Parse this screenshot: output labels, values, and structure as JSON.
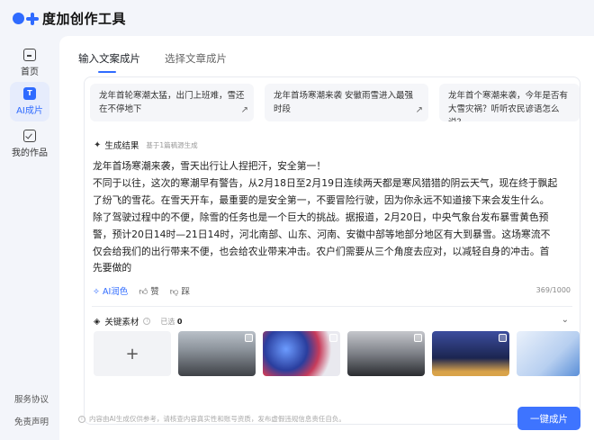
{
  "app": {
    "title": "度加创作工具"
  },
  "sidebar": {
    "items": [
      {
        "label": "首页",
        "icon": "home-icon"
      },
      {
        "label": "AI成片",
        "icon": "ai-icon",
        "active": true
      },
      {
        "label": "我的作品",
        "icon": "check-icon"
      }
    ],
    "links": [
      "服务协议",
      "免责声明"
    ]
  },
  "main": {
    "tabs": [
      {
        "label": "输入文案成片",
        "active": true
      },
      {
        "label": "选择文章成片",
        "active": false
      }
    ],
    "suggestions": [
      "龙年首轮寒潮太猛，出门上班难，雪还在不停地下",
      "龙年首场寒潮来袭 安徽雨雪进入最强时段",
      "龙年首个寒潮来袭，今年是否有大雪灾祸？听听农民谚语怎么说？"
    ],
    "result": {
      "title": "生成结果",
      "subtitle": "基于1篇稿源生成",
      "body": "龙年首场寒潮来袭，雪天出行让人捏把汗，安全第一！\n不同于以往，这次的寒潮早有警告，从2月18日至2月19日连续两天都是寒风猎猎的阴云天气，现在终于飘起了纷飞的雪花。在雪天开车，最重要的是安全第一，不要冒险行驶，因为你永远不知道接下来会发生什么。除了驾驶过程中的不便，除雪的任务也是一个巨大的挑战。据报道，2月20日，中央气象台发布暴雪黄色预警，预计20日14时—21日14时，河北南部、山东、河南、安徽中部等地部分地区有大到暴雪。这场寒流不仅会给我们的出行带来不便，也会给农业带来冲击。农户们需要从三个角度去应对，以减轻自身的冲击。首先要做的",
      "actions": {
        "ai": "AI润色",
        "like": "赞",
        "dislike": "踩"
      },
      "counter": "369/1000"
    },
    "materials": {
      "title": "关键素材",
      "selected_label": "已选",
      "selected_count": "0",
      "add": "+"
    },
    "footer_note": "内容由AI生成仅供参考，请核查内容真实性和账号资质，发布虚假违规信息责任自负。",
    "generate_button": "一键成片"
  },
  "colors": {
    "accent": "#2f6bff",
    "button": "#3e74ff"
  }
}
